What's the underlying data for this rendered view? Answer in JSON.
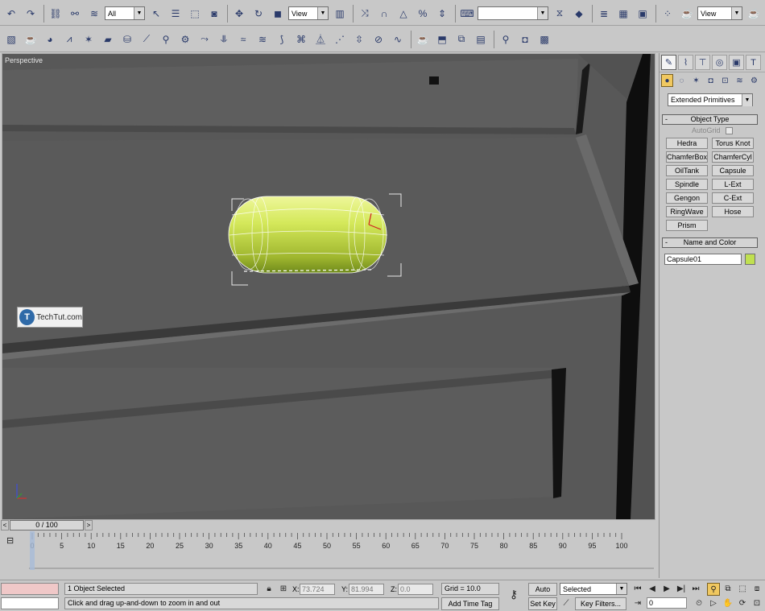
{
  "toolbar1": {
    "selection_filter": "All",
    "ref_coord_system": "View",
    "named_selection": "",
    "render_view": "View",
    "icons": [
      "undo-icon",
      "redo-icon",
      "select-link-icon",
      "unlink-icon",
      "bind-spacewarp-icon",
      "select-object-icon",
      "select-by-name-icon",
      "rect-selection-icon",
      "window-crossing-icon",
      "move-icon",
      "rotate-icon",
      "scale-icon",
      "pivot-icon",
      "mirror-icon",
      "align-icon",
      "snap-icon",
      "angle-snap-icon",
      "percent-snap-icon",
      "spinner-snap-icon",
      "edit-named-sets-icon",
      "mirror-tool-icon",
      "align-tool-icon",
      "layer-manager-icon",
      "curve-editor-icon",
      "schematic-view-icon",
      "material-editor-icon",
      "render-setup-icon",
      "quick-render-icon"
    ]
  },
  "toolbar2": {
    "icons": [
      "box-icon",
      "teapot-icon",
      "sphere-icon",
      "cone-icon",
      "star-icon",
      "plane-icon",
      "cylinder-icon",
      "bone-icon",
      "gear-icon",
      "wind-icon",
      "gravity-icon",
      "ripple-icon",
      "wave-icon",
      "bend-icon",
      "twist-icon",
      "taper-icon",
      "noise-icon",
      "stretch-icon",
      "skew-icon",
      "lattice-icon",
      "teapot2-icon",
      "cube-icon",
      "layers-icon",
      "magnifier-icon",
      "camera-icon",
      "film-icon"
    ]
  },
  "viewport": {
    "label": "Perspective",
    "object_color": "#c8e04a",
    "background_color": "#5a5a5a"
  },
  "watermark": {
    "logo_letter": "T",
    "text": "TechTut.com"
  },
  "command_panel": {
    "tabs": [
      "create-tab",
      "modify-tab",
      "hierarchy-tab",
      "motion-tab",
      "display-tab",
      "utilities-tab"
    ],
    "subtabs": [
      "geometry-subtab",
      "shapes-subtab",
      "lights-subtab",
      "cameras-subtab",
      "helpers-subtab",
      "spacewarps-subtab",
      "systems-subtab"
    ],
    "category": "Extended Primitives",
    "object_type_title": "Object Type",
    "autogrid_label": "AutoGrid",
    "object_buttons": [
      "Hedra",
      "Torus Knot",
      "ChamferBox",
      "ChamferCyl",
      "OilTank",
      "Capsule",
      "Spindle",
      "L-Ext",
      "Gengon",
      "C-Ext",
      "RingWave",
      "Hose",
      "Prism"
    ],
    "name_color_title": "Name and Color",
    "object_name": "Capsule01",
    "object_color": "#c0e050"
  },
  "time_slider": {
    "left_arrow": "<",
    "position_label": "0 / 100",
    "right_arrow": ">"
  },
  "trackbar": {
    "ticks": [
      0,
      5,
      10,
      15,
      20,
      25,
      30,
      35,
      40,
      45,
      50,
      55,
      60,
      65,
      70,
      75,
      80,
      85,
      90,
      95,
      100
    ]
  },
  "status_bar": {
    "selection_status": "1 Object Selected",
    "prompt": "Click and drag up-and-down to zoom in and out",
    "x_label": "X:",
    "x_value": "73.724",
    "y_label": "Y:",
    "y_value": "81.994",
    "z_label": "Z:",
    "z_value": "0.0",
    "grid": "Grid = 10.0",
    "add_time_tag": "Add Time Tag",
    "auto_key": "Auto Key",
    "set_key": "Set Key",
    "key_mode": "Selected",
    "key_filters": "Key Filters...",
    "current_frame": "0"
  }
}
